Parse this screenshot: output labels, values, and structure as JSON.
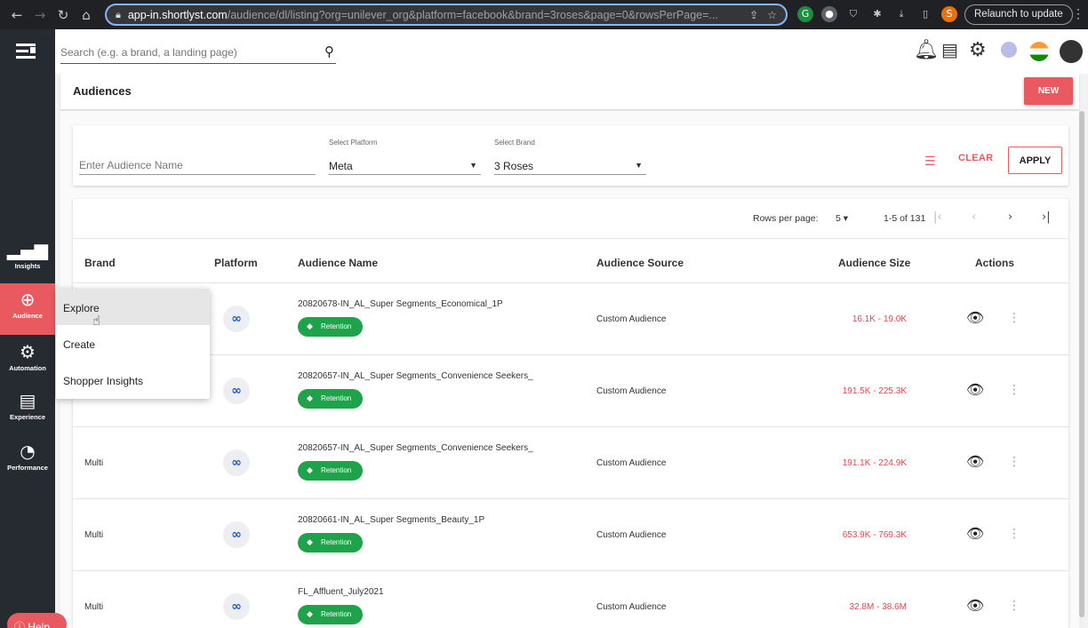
{
  "browser": {
    "url_host": "app-in.shortlyst.com",
    "url_path": "/audience/dl/listing?org=unilever_org&platform=facebook&brand=3roses&page=0&rowsPerPage=...",
    "relaunch_label": "Relaunch to update",
    "profile_initial": "S"
  },
  "topbar": {
    "search_placeholder": "Search (e.g. a brand, a landing page)",
    "icons": [
      "bell-icon",
      "document-icon",
      "gear-icon",
      "user-avatar",
      "flag-icon",
      "account-icon"
    ]
  },
  "sidebar": {
    "items": [
      {
        "label": "Insights",
        "icon": "bar-chart-icon"
      },
      {
        "label": "Audience",
        "icon": "target-icon",
        "active": true
      },
      {
        "label": "Automation",
        "icon": "automation-gear-icon"
      },
      {
        "label": "Experience",
        "icon": "layout-icon"
      },
      {
        "label": "Performance",
        "icon": "gauge-icon"
      }
    ],
    "help_label": "Help"
  },
  "menu": {
    "items": [
      "Explore",
      "Create",
      "Shopper Insights"
    ]
  },
  "page": {
    "title": "Audiences",
    "new_label": "NEW"
  },
  "filters": {
    "name_placeholder": "Enter Audience Name",
    "platform_caption": "Select Platform",
    "platform_value": "Meta",
    "brand_caption": "Select Brand",
    "brand_value": "3 Roses",
    "clear_label": "CLEAR",
    "apply_label": "APPLY"
  },
  "pagination": {
    "rows_label": "Rows per page:",
    "rows_value": "5",
    "range": "1-5 of 131"
  },
  "table": {
    "headers": [
      "Brand",
      "Platform",
      "Audience Name",
      "Audience Source",
      "Audience Size",
      "Actions"
    ],
    "rows": [
      {
        "brand": "",
        "name": "20820678-IN_AL_Super Segments_Economical_1P",
        "tag": "Retention",
        "source": "Custom Audience",
        "size": "16.1K - 19.0K"
      },
      {
        "brand": "",
        "name": "20820657-IN_AL_Super Segments_Convenience Seekers_",
        "tag": "Retention",
        "source": "Custom Audience",
        "size": "191.5K - 225.3K"
      },
      {
        "brand": "Multi",
        "name": "20820657-IN_AL_Super Segments_Convenience Seekers_",
        "tag": "Retention",
        "source": "Custom Audience",
        "size": "191.1K - 224.9K"
      },
      {
        "brand": "Multi",
        "name": "20820661-IN_AL_Super Segments_Beauty_1P",
        "tag": "Retention",
        "source": "Custom Audience",
        "size": "653.9K - 769.3K"
      },
      {
        "brand": "Multi",
        "name": "FL_Affluent_July2021",
        "tag": "Retention",
        "source": "Custom Audience",
        "size": "32.8M - 38.6M"
      }
    ]
  },
  "colors": {
    "accent": "#e85a5f",
    "sidebar": "#262a31",
    "badge": "#1fa34a",
    "meta_blue": "#1a5bd6"
  }
}
